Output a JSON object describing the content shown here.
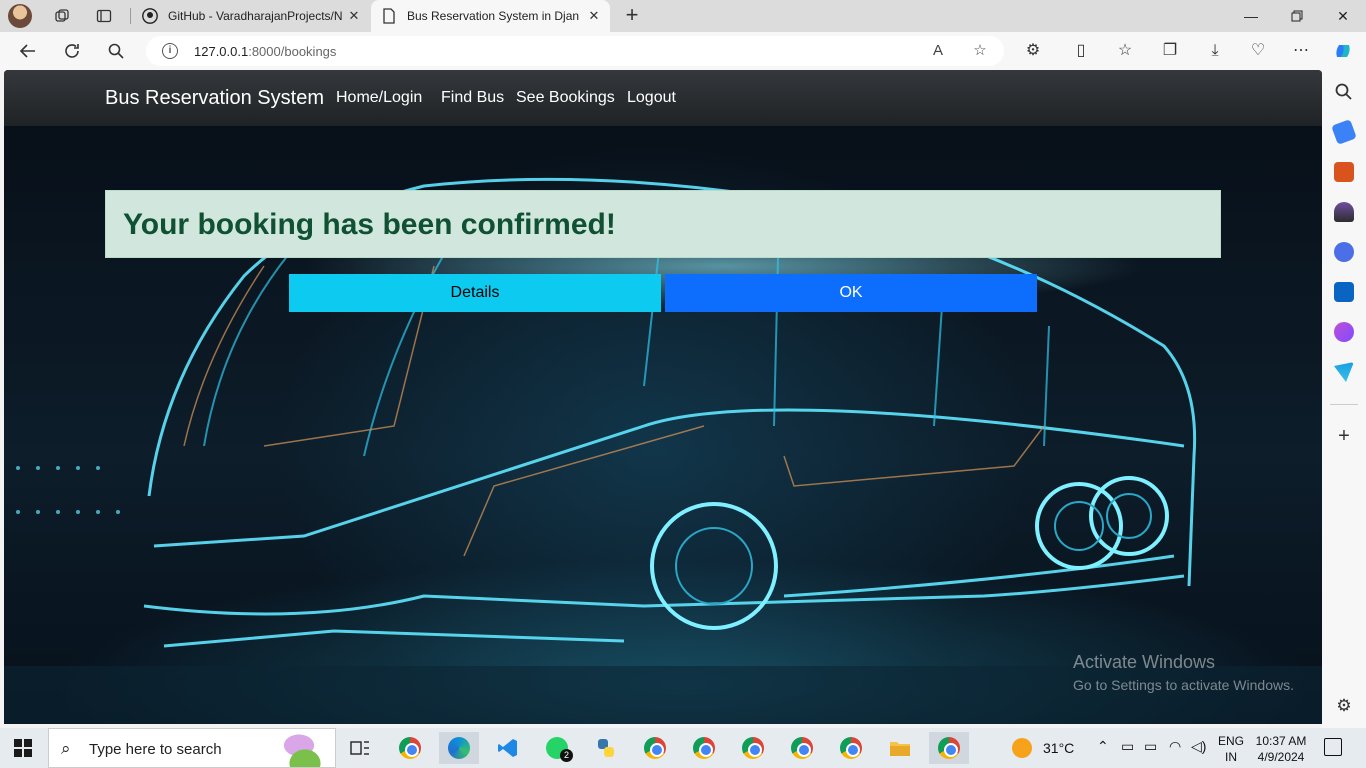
{
  "browser": {
    "tabs": [
      {
        "title": "GitHub - VaradharajanProjects/N",
        "active": false
      },
      {
        "title": "Bus Reservation System in Djang",
        "active": true
      }
    ],
    "url_host": "127.0.0.1",
    "url_path": ":8000/bookings"
  },
  "navbar": {
    "brand": "Bus Reservation System",
    "links": [
      "Home/Login",
      "Find Bus",
      "See Bookings",
      "Logout"
    ]
  },
  "alert": {
    "message": "Your booking has been confirmed!"
  },
  "buttons": {
    "details": "Details",
    "ok": "OK"
  },
  "watermark": {
    "line1": "Activate Windows",
    "line2": "Go to Settings to activate Windows."
  },
  "taskbar": {
    "search_placeholder": "Type here to search",
    "whatsapp_badge": "2",
    "temperature": "31°C",
    "lang_top": "ENG",
    "lang_bottom": "IN",
    "time": "10:37 AM",
    "date": "4/9/2024"
  },
  "colors": {
    "alert_bg": "#d1e7dd",
    "alert_text": "#0f5132",
    "details_btn": "#0dcaf0",
    "ok_btn": "#0d6efd"
  }
}
